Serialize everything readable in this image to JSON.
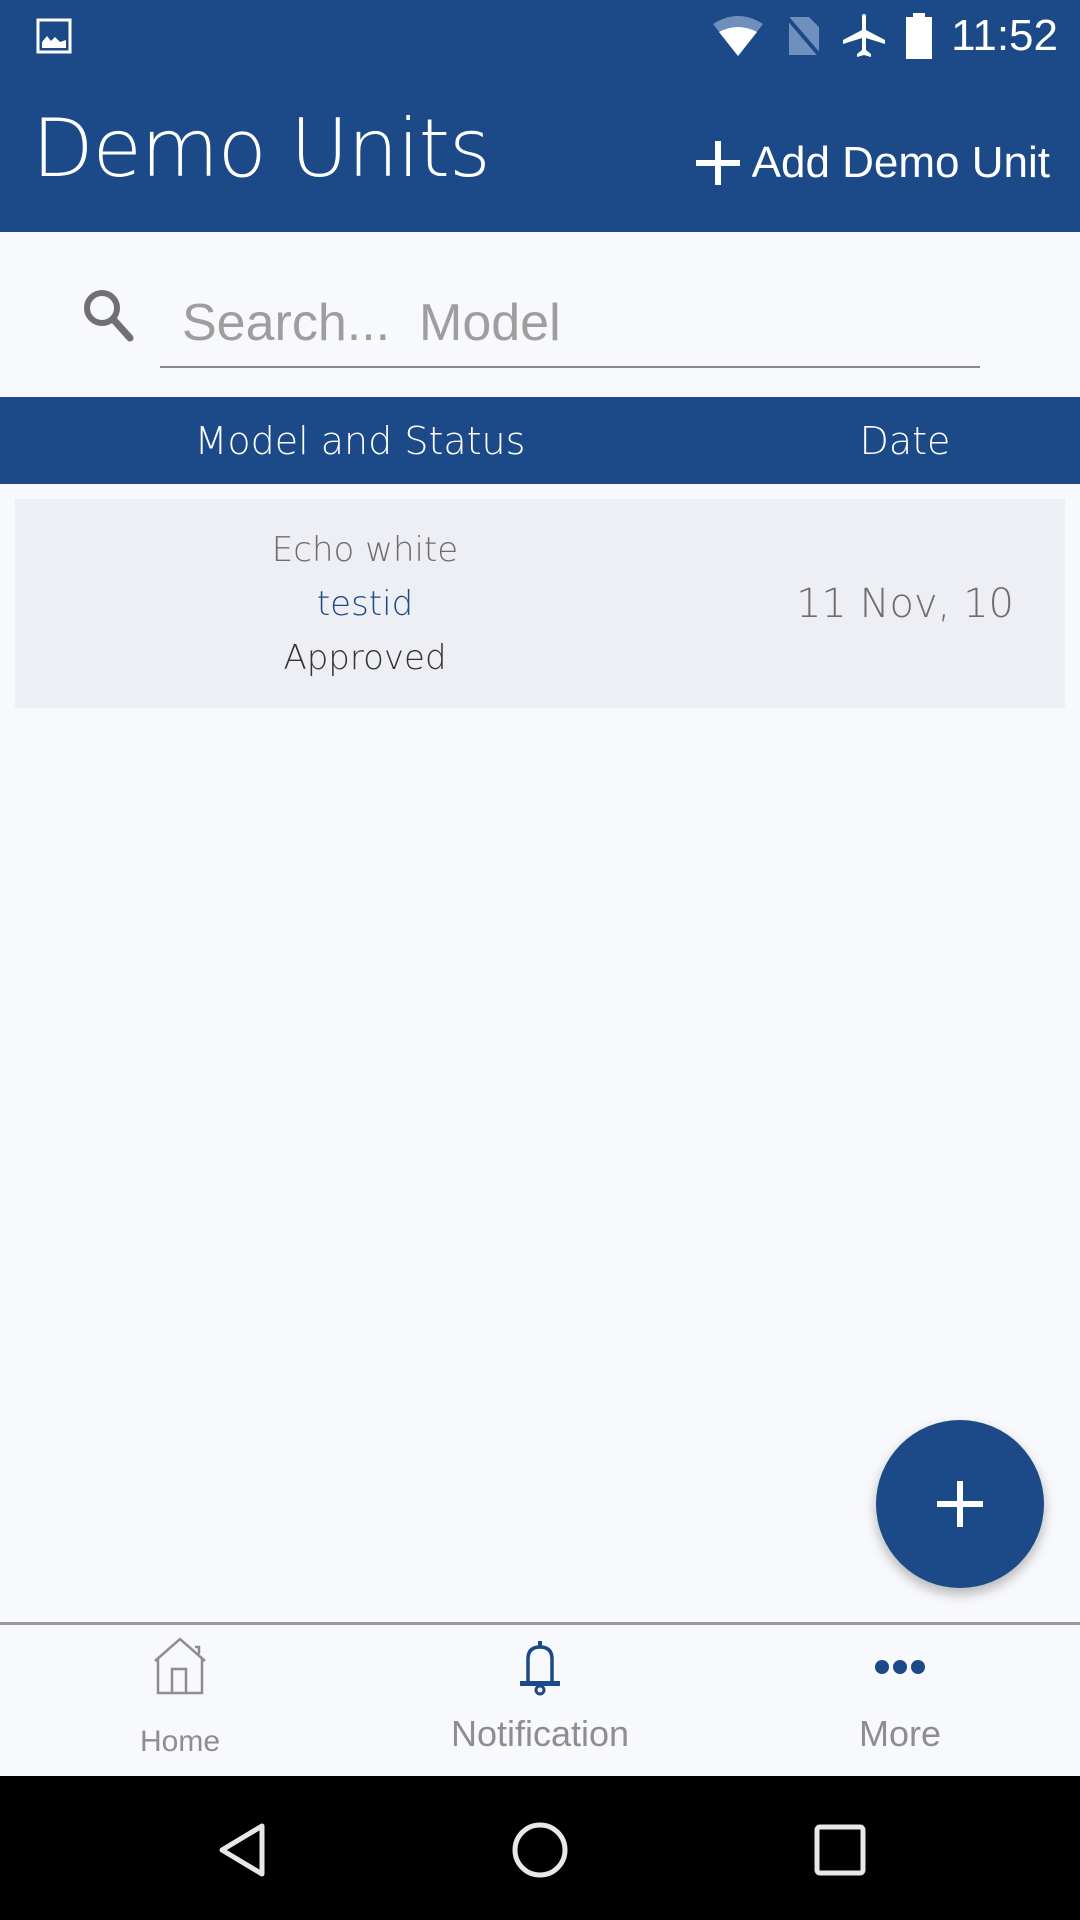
{
  "status_bar": {
    "time": "11:52",
    "icons": [
      "gallery-icon",
      "wifi-icon",
      "no-sim-icon",
      "airplane-icon",
      "battery-icon"
    ]
  },
  "app_bar": {
    "title": "Demo Units",
    "add_button_label": "Add Demo Unit",
    "add_button_icon": "plus-icon"
  },
  "search": {
    "placeholder": "Search...  Model",
    "value": "",
    "icon": "search-icon"
  },
  "table": {
    "columns": [
      "Model and Status",
      "Date"
    ],
    "rows": [
      {
        "model": "Echo white",
        "id": "testid",
        "status": "Approved",
        "date": "11 Nov, 10"
      }
    ]
  },
  "fab": {
    "icon": "plus-icon"
  },
  "bottom_nav": {
    "items": [
      {
        "label": "Home",
        "icon": "home-icon"
      },
      {
        "label": "Notification",
        "icon": "bell-icon"
      },
      {
        "label": "More",
        "icon": "more-dots-icon"
      }
    ]
  },
  "system_nav": {
    "buttons": [
      "back",
      "home",
      "recents"
    ]
  },
  "colors": {
    "primary": "#1c4988",
    "background": "#f8f9fd",
    "row_background": "#eeeff4",
    "muted_text": "#8e8e8e"
  }
}
